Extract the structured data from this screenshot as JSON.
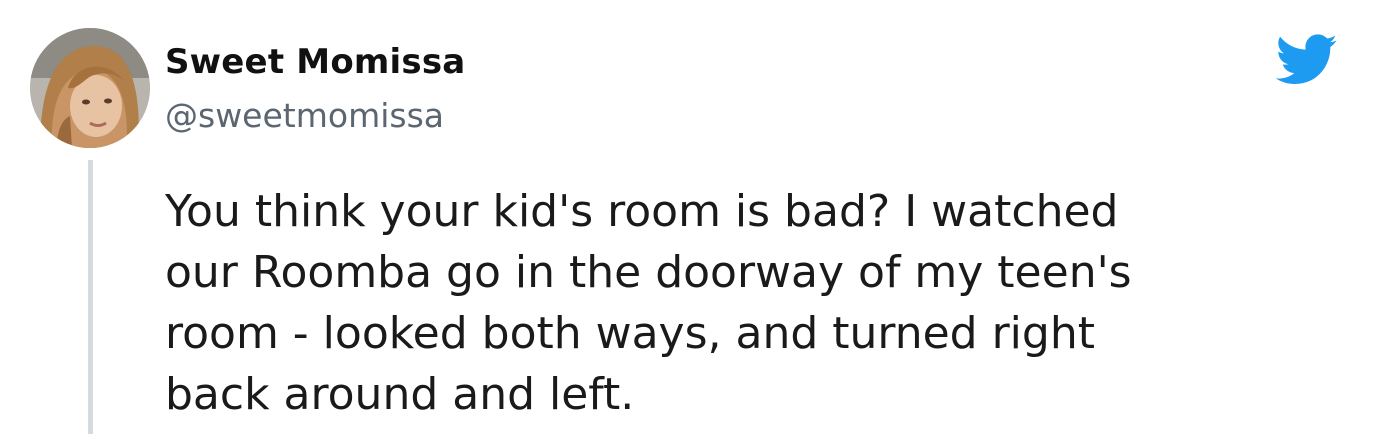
{
  "author": {
    "display_name": "Sweet Momissa",
    "handle": "@sweetmomissa",
    "avatar_icon": "profile-photo"
  },
  "tweet": {
    "text_lines": [
      "You think your kid's room is bad? I watched",
      "our Roomba go in the doorway of my teen's",
      "room - looked both ways, and turned right",
      "back around and left."
    ]
  },
  "brand": {
    "icon": "twitter-bird-icon",
    "color": "#1d9bf0"
  },
  "colors": {
    "thread_line": "#d3dbe0",
    "handle": "#5b6670",
    "text": "#1a1a1a"
  }
}
